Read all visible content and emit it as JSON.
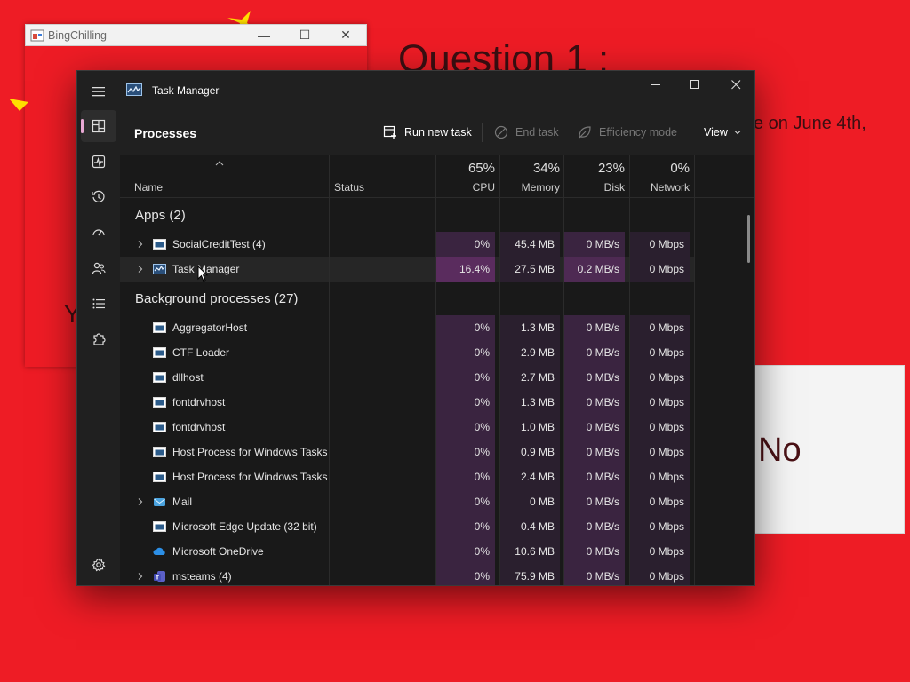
{
  "background_app": {
    "title": "BingChilling",
    "question": "Question 1 :",
    "question_fragment": "e on June 4th,",
    "partial_letter": "Y",
    "no_button": "No"
  },
  "task_manager": {
    "title": "Task Manager",
    "page_title": "Processes",
    "commands": {
      "run_new_task": "Run new task",
      "end_task": "End task",
      "efficiency_mode": "Efficiency mode",
      "view": "View"
    },
    "columns": {
      "name": "Name",
      "status": "Status",
      "cpu": {
        "percent": "65%",
        "label": "CPU"
      },
      "memory": {
        "percent": "34%",
        "label": "Memory"
      },
      "disk": {
        "percent": "23%",
        "label": "Disk"
      },
      "network": {
        "percent": "0%",
        "label": "Network"
      }
    },
    "groups": {
      "apps": "Apps (2)",
      "background": "Background processes (27)"
    },
    "apps": [
      {
        "name": "SocialCreditTest (4)",
        "cpu": "0%",
        "memory": "45.4 MB",
        "disk": "0 MB/s",
        "network": "0 Mbps"
      },
      {
        "name": "Task Manager",
        "cpu": "16.4%",
        "memory": "27.5 MB",
        "disk": "0.2 MB/s",
        "network": "0 Mbps"
      }
    ],
    "background": [
      {
        "name": "AggregatorHost",
        "cpu": "0%",
        "memory": "1.3 MB",
        "disk": "0 MB/s",
        "network": "0 Mbps"
      },
      {
        "name": "CTF Loader",
        "cpu": "0%",
        "memory": "2.9 MB",
        "disk": "0 MB/s",
        "network": "0 Mbps"
      },
      {
        "name": "dllhost",
        "cpu": "0%",
        "memory": "2.7 MB",
        "disk": "0 MB/s",
        "network": "0 Mbps"
      },
      {
        "name": "fontdrvhost",
        "cpu": "0%",
        "memory": "1.3 MB",
        "disk": "0 MB/s",
        "network": "0 Mbps"
      },
      {
        "name": "fontdrvhost",
        "cpu": "0%",
        "memory": "1.0 MB",
        "disk": "0 MB/s",
        "network": "0 Mbps"
      },
      {
        "name": "Host Process for Windows Tasks",
        "cpu": "0%",
        "memory": "0.9 MB",
        "disk": "0 MB/s",
        "network": "0 Mbps"
      },
      {
        "name": "Host Process for Windows Tasks",
        "cpu": "0%",
        "memory": "2.4 MB",
        "disk": "0 MB/s",
        "network": "0 Mbps"
      },
      {
        "name": "Mail",
        "cpu": "0%",
        "memory": "0 MB",
        "disk": "0 MB/s",
        "network": "0 Mbps"
      },
      {
        "name": "Microsoft Edge Update (32 bit)",
        "cpu": "0%",
        "memory": "0.4 MB",
        "disk": "0 MB/s",
        "network": "0 Mbps"
      },
      {
        "name": "Microsoft OneDrive",
        "cpu": "0%",
        "memory": "10.6 MB",
        "disk": "0 MB/s",
        "network": "0 Mbps"
      },
      {
        "name": "msteams (4)",
        "cpu": "0%",
        "memory": "75.9 MB",
        "disk": "0 MB/s",
        "network": "0 Mbps"
      }
    ]
  }
}
